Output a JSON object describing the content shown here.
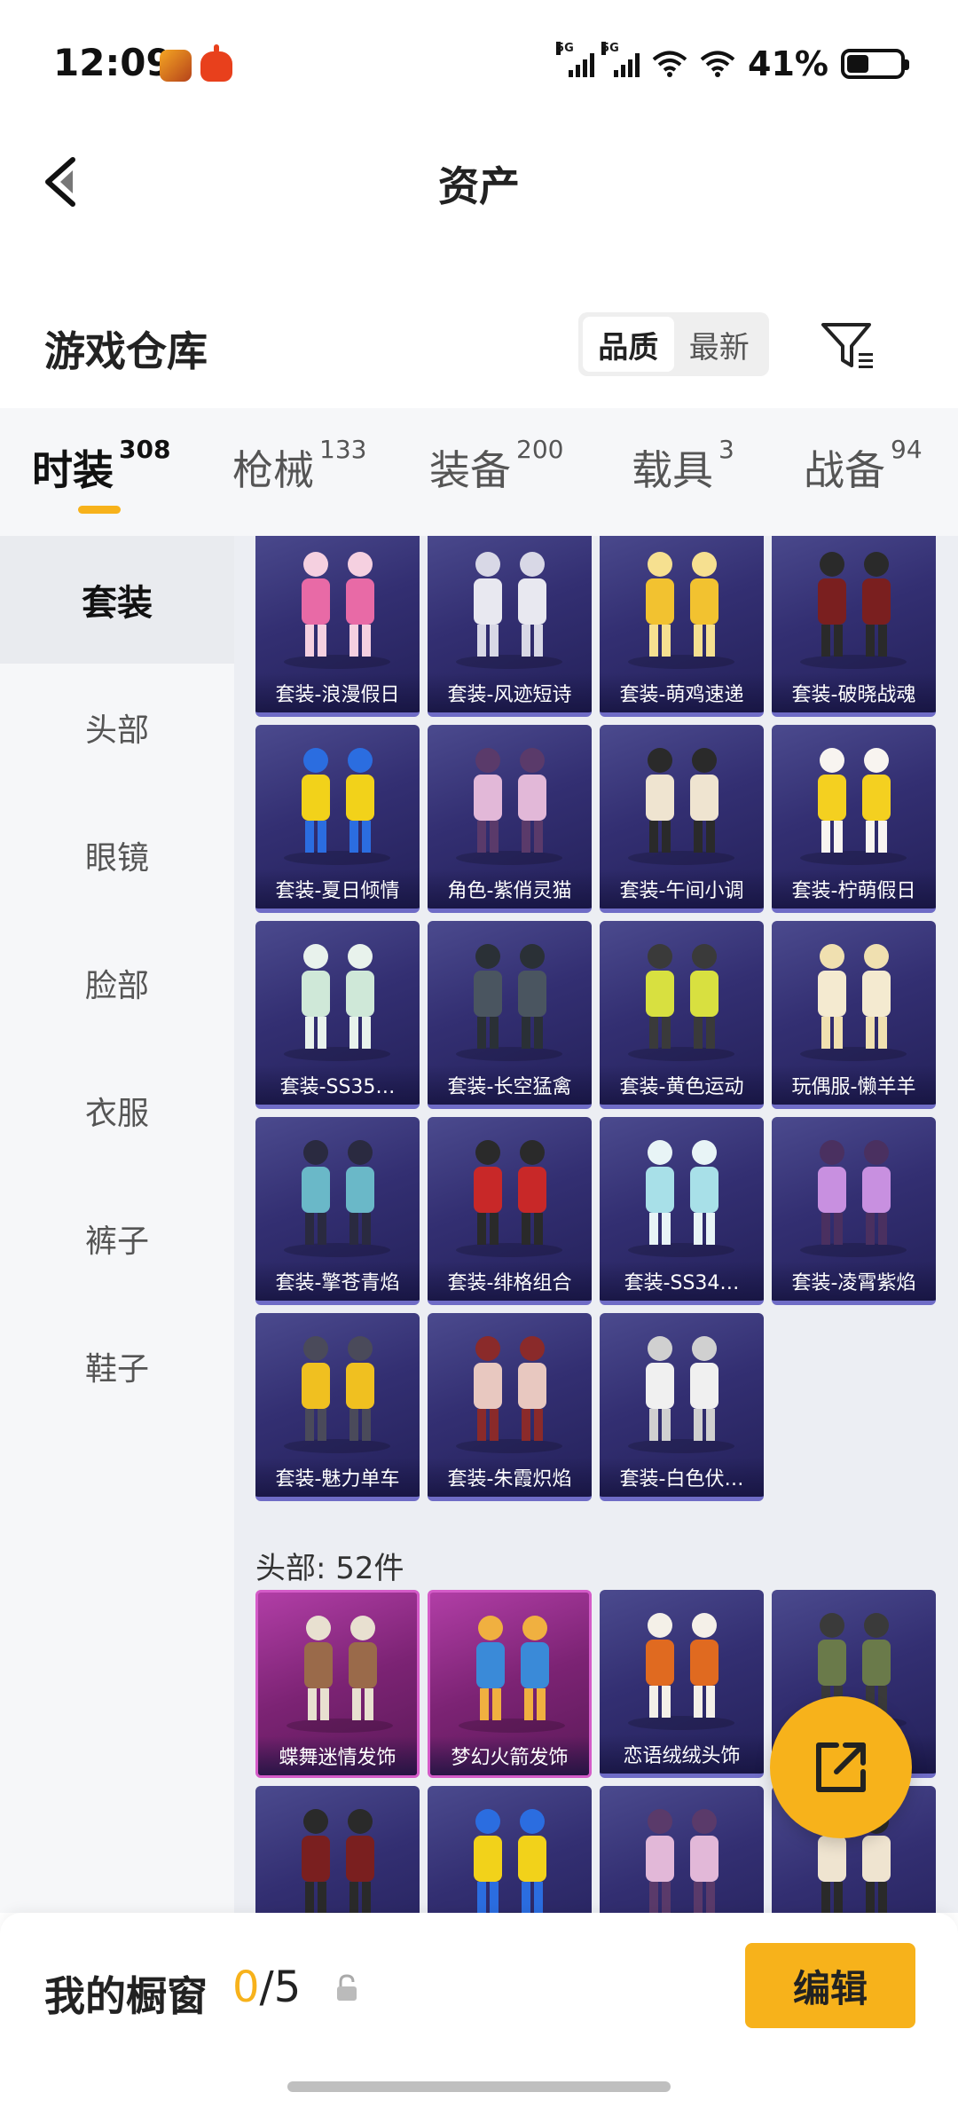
{
  "status": {
    "time": "12:09",
    "battery_pct": "41%",
    "sig1_tag": "5G",
    "sig2_tag": "5G"
  },
  "header": {
    "title": "资产"
  },
  "section": {
    "title": "游戏仓库",
    "sort": [
      "品质",
      "最新"
    ],
    "active_sort": "品质"
  },
  "tabs": [
    {
      "label": "时装",
      "count": "308"
    },
    {
      "label": "枪械",
      "count": "133"
    },
    {
      "label": "装备",
      "count": "200"
    },
    {
      "label": "载具",
      "count": "3"
    },
    {
      "label": "战备",
      "count": "94"
    }
  ],
  "sidebar": {
    "items": [
      "套装",
      "头部",
      "眼镜",
      "脸部",
      "衣服",
      "裤子",
      "鞋子"
    ]
  },
  "outfits": [
    "套装-浪漫假日",
    "套装-风迹短诗",
    "套装-萌鸡速递",
    "套装-破晓战魂",
    "套装-夏日倾情",
    "角色-紫俏灵猫",
    "套装-午间小调",
    "套装-柠萌假日",
    "套装-SS35…",
    "套装-长空猛禽",
    "套装-黄色运动",
    "玩偶服-懒羊羊",
    "套装-擎苍青焰",
    "套装-绯格组合",
    "套装-SS34…",
    "套装-凌霄紫焰",
    "套装-魅力单车",
    "套装-朱霞炽焰",
    "套装-白色伏…"
  ],
  "head_group": {
    "title": "头部: 52件",
    "items": [
      "蝶舞迷情发饰",
      "梦幻火箭发饰",
      "恋语绒绒头饰",
      ""
    ]
  },
  "showcase": {
    "label": "我的橱窗",
    "current": "0",
    "total": "/5",
    "edit_label": "编辑"
  },
  "colors": {
    "accent": "#f7b21b",
    "card_bg": "#332f72",
    "card_pink": "#b13ea6"
  }
}
